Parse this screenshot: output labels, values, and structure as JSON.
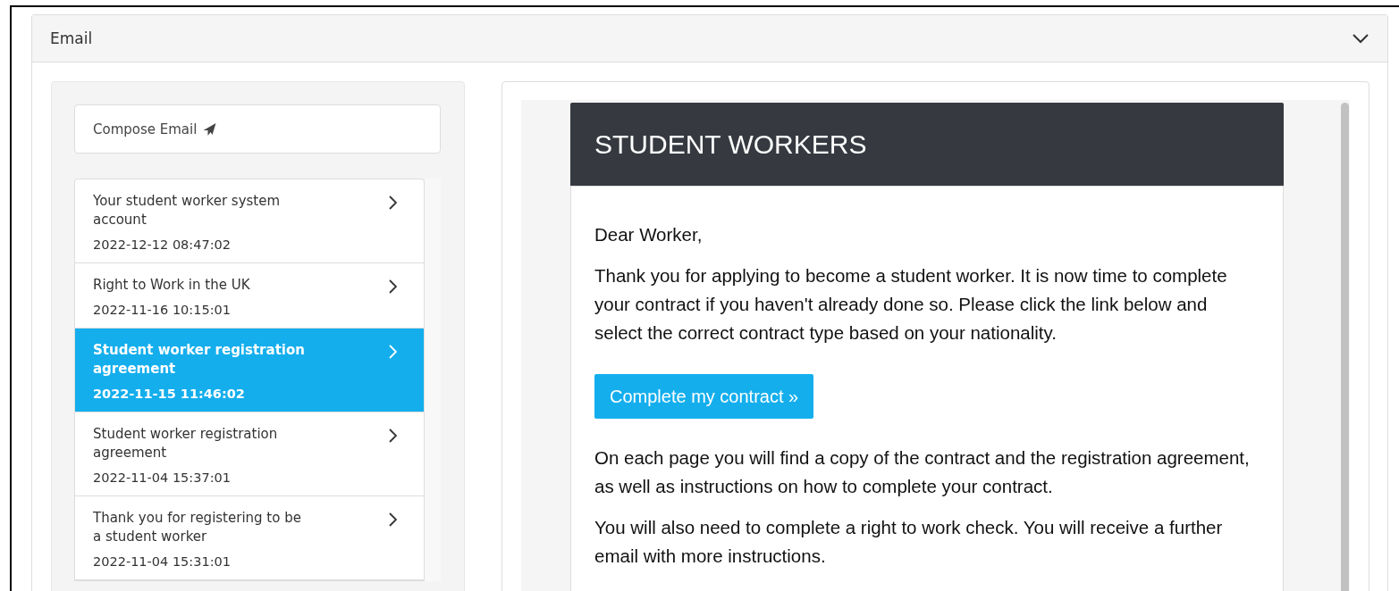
{
  "panel": {
    "title": "Email",
    "expanded": true
  },
  "compose_button": {
    "label": "Compose Email"
  },
  "messages": [
    {
      "subject": "Your student worker system account",
      "date": "2022-12-12 08:47:02",
      "selected": false
    },
    {
      "subject": "Right to Work in the UK",
      "date": "2022-11-16 10:15:01",
      "selected": false
    },
    {
      "subject": "Student worker registration agreement",
      "date": "2022-11-15 11:46:02",
      "selected": true
    },
    {
      "subject": "Student worker registration agreement",
      "date": "2022-11-04 15:37:01",
      "selected": false
    },
    {
      "subject": "Thank you for registering to be a student worker",
      "date": "2022-11-04 15:31:01",
      "selected": false
    }
  ],
  "email": {
    "banner": "STUDENT WORKERS",
    "blocks": [
      {
        "kind": "text",
        "text": "Dear Worker,"
      },
      {
        "kind": "text",
        "text": "Thank you for applying to become a student worker. It is now time to complete your contract if you haven't already done so. Please click the link below and select the correct contract type based on your nationality."
      },
      {
        "kind": "button",
        "text": "Complete my contract »"
      },
      {
        "kind": "text",
        "text": "On each page you will find a copy of the contract and the registration agreement, as well as instructions on how to complete your contract."
      },
      {
        "kind": "text",
        "text": "You will also need to complete a right to work check. You will receive a further email with more instructions."
      }
    ]
  }
}
